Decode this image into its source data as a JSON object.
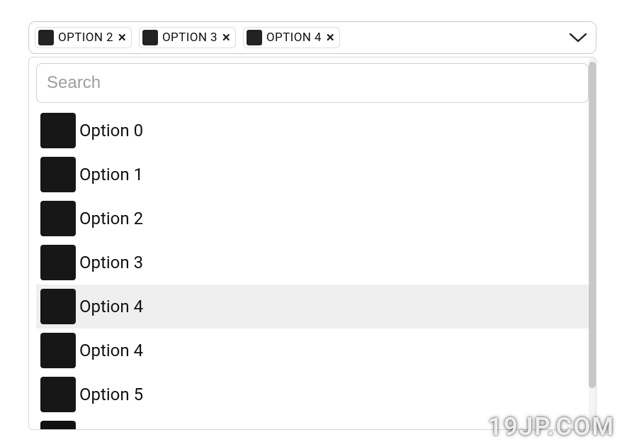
{
  "search": {
    "placeholder": "Search",
    "value": ""
  },
  "chips": [
    {
      "label": "OPTION 2"
    },
    {
      "label": "OPTION 3"
    },
    {
      "label": "OPTION 4"
    }
  ],
  "options": [
    {
      "label": "Option 0",
      "highlighted": false
    },
    {
      "label": "Option 1",
      "highlighted": false
    },
    {
      "label": "Option 2",
      "highlighted": false
    },
    {
      "label": "Option 3",
      "highlighted": false
    },
    {
      "label": "Option 4",
      "highlighted": true
    },
    {
      "label": "Option 4",
      "highlighted": false
    },
    {
      "label": "Option 5",
      "highlighted": false
    }
  ],
  "watermark": "19JP.COM"
}
